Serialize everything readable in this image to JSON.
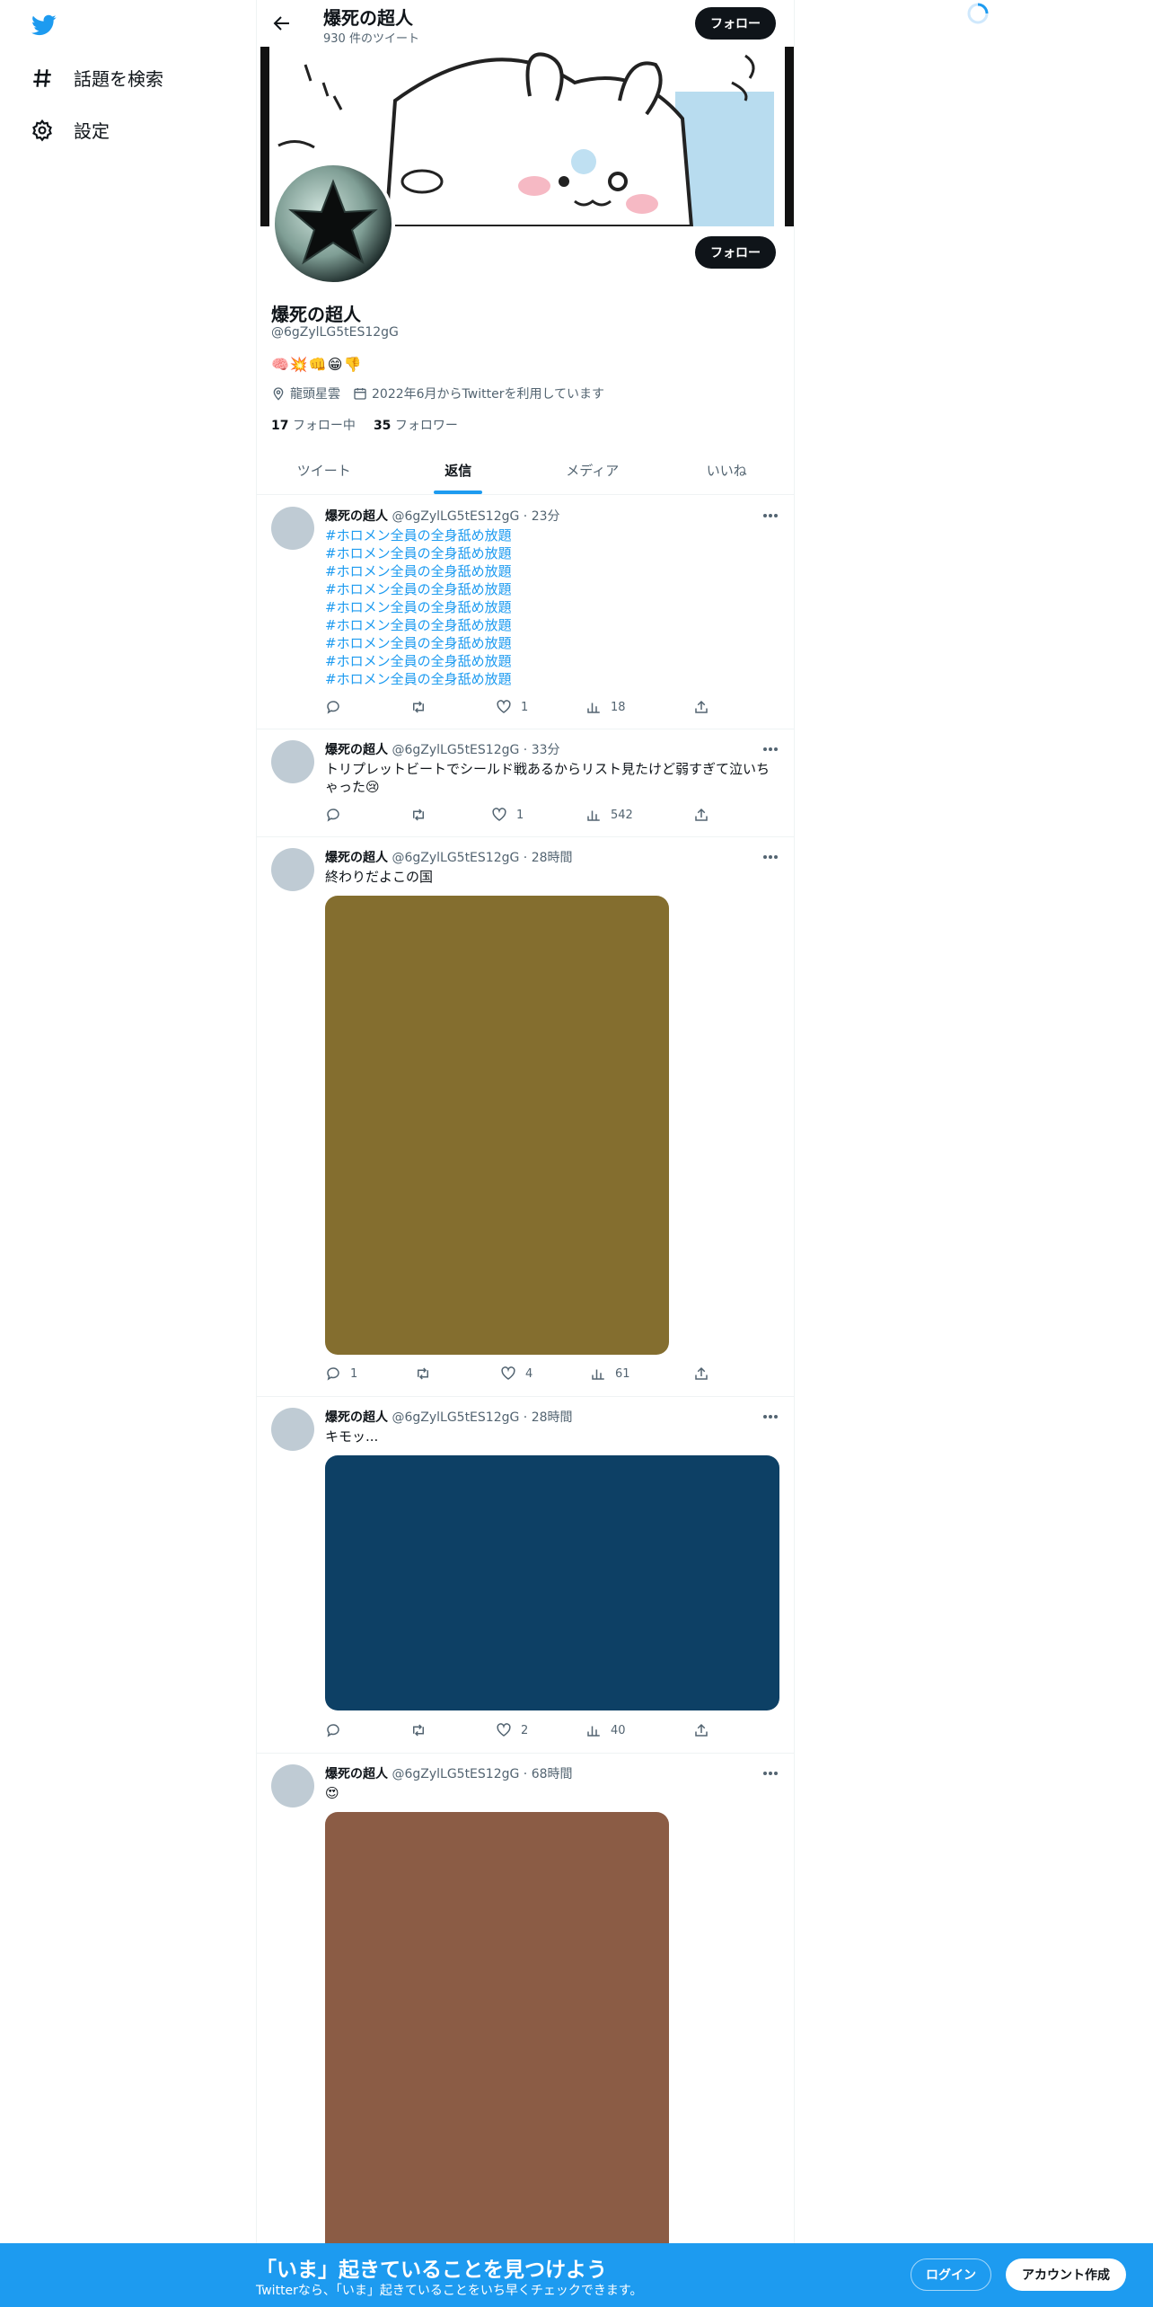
{
  "nav": {
    "explore_label": "話題を検索",
    "settings_label": "設定"
  },
  "header": {
    "name": "爆死の超人",
    "tweet_count": "930 件のツイート",
    "follow_label": "フォロー"
  },
  "profile": {
    "name": "爆死の超人",
    "handle": "@6gZylLG5tES12gG",
    "bio": "🧠💥👊😁👎",
    "location": "龍頭星雲",
    "joined": "2022年6月からTwitterを利用しています",
    "following_count": "17",
    "following_label": "フォロー中",
    "followers_count": "35",
    "followers_label": "フォロワー",
    "follow_label": "フォロー"
  },
  "tabs": [
    "ツイート",
    "返信",
    "メディア",
    "いいね"
  ],
  "tweets": [
    {
      "name": "爆死の超人",
      "meta": "@6gZylLG5tES12gG · 23分",
      "hashtags": [
        "#ホロメン全員の全身舐め放題",
        "#ホロメン全員の全身舐め放題",
        "#ホロメン全員の全身舐め放題",
        "#ホロメン全員の全身舐め放題",
        "#ホロメン全員の全身舐め放題",
        "#ホロメン全員の全身舐め放題",
        "#ホロメン全員の全身舐め放題",
        "#ホロメン全員の全身舐め放題",
        "#ホロメン全員の全身舐め放題"
      ],
      "reply_count": "",
      "like_count": "1",
      "view_count": "18"
    },
    {
      "name": "爆死の超人",
      "meta": "@6gZylLG5tES12gG · 33分",
      "text": "トリプレットビートでシールド戦あるからリスト見たけど弱すぎて泣いちゃった😢",
      "reply_count": "",
      "like_count": "1",
      "view_count": "542"
    },
    {
      "name": "爆死の超人",
      "meta": "@6gZylLG5tES12gG · 28時間",
      "text": "終わりだよこの国",
      "media_color": "#846e2f",
      "reply_count": "1",
      "like_count": "4",
      "view_count": "61"
    },
    {
      "name": "爆死の超人",
      "meta": "@6gZylLG5tES12gG · 28時間",
      "text": "キモッ...",
      "media_color": "#0d4065",
      "reply_count": "",
      "like_count": "2",
      "view_count": "40"
    },
    {
      "name": "爆死の超人",
      "meta": "@6gZylLG5tES12gG · 68時間",
      "text": "😍",
      "media_color": "#8b5c45"
    }
  ],
  "bottom_bar": {
    "title": "「いま」起きていることを見つけよう",
    "subtitle": "Twitterなら、「いま」起きていることをいち早くチェックできます。",
    "login_label": "ログイン",
    "signup_label": "アカウント作成"
  },
  "colors": {
    "accent": "#1d9bf0",
    "follow_button": "#0f1419"
  }
}
